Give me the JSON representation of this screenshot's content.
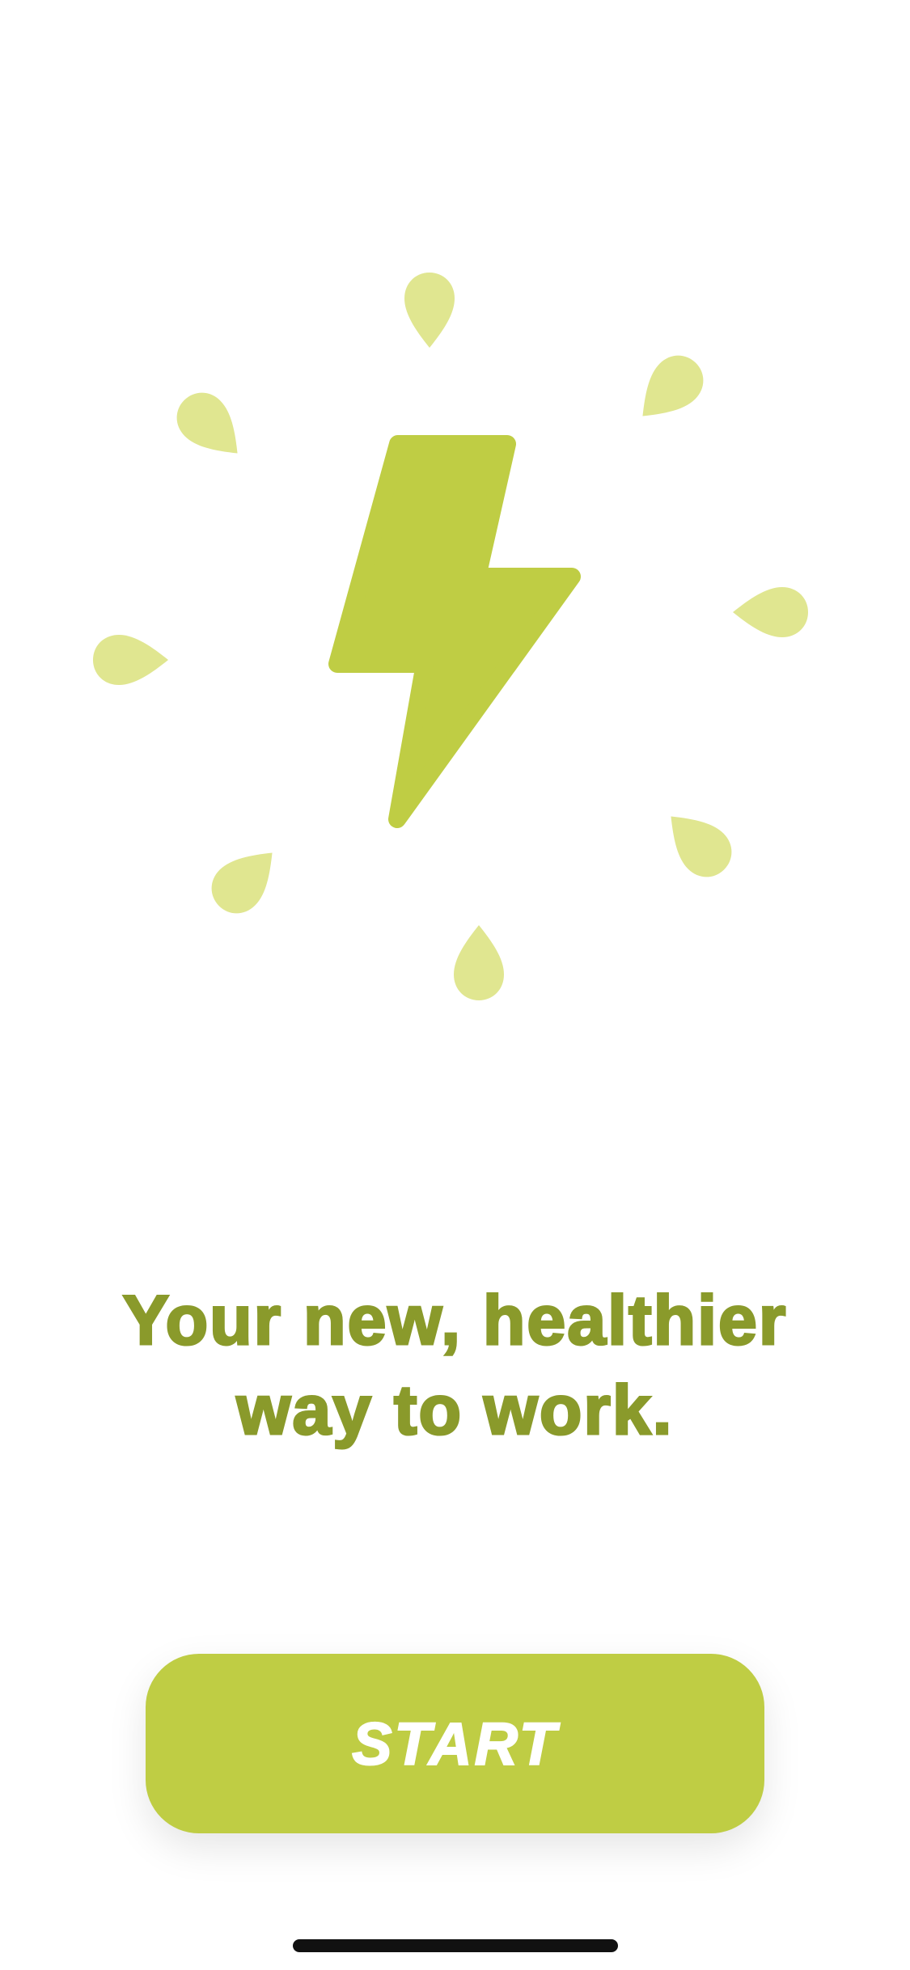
{
  "onboarding": {
    "headline_line1": "Your new, healthier",
    "headline_line2": "way to work.",
    "start_label": "START"
  },
  "icons": {
    "main": "lightning-bolt-icon",
    "decoration": "droplet-icon"
  },
  "colors": {
    "accent": "#bfcd44",
    "droplet": "#e0e690",
    "headline": "#8a9a2b",
    "button_text": "#ffffff",
    "background": "#ffffff"
  }
}
